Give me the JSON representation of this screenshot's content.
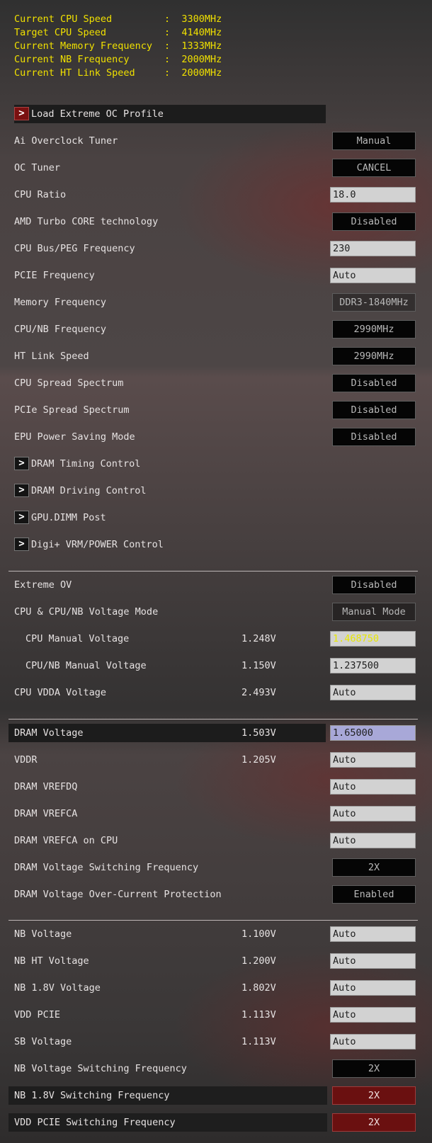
{
  "info": [
    {
      "label": "Current CPU Speed",
      "value": "3300MHz"
    },
    {
      "label": "Target CPU Speed",
      "value": "4140MHz"
    },
    {
      "label": "Current Memory Frequency",
      "value": "1333MHz"
    },
    {
      "label": "Current NB Frequency",
      "value": "2000MHz"
    },
    {
      "label": "Current HT Link Speed",
      "value": "2000MHz"
    }
  ],
  "load_profile": "Load Extreme OC Profile",
  "items": {
    "ai_overclock": {
      "label": "Ai Overclock Tuner",
      "value": "Manual"
    },
    "oc_tuner": {
      "label": "OC Tuner",
      "value": "CANCEL"
    },
    "cpu_ratio": {
      "label": "CPU Ratio",
      "value": "18.0"
    },
    "amd_turbo": {
      "label": "AMD Turbo CORE technology",
      "value": "Disabled"
    },
    "cpu_bus": {
      "label": "CPU Bus/PEG Frequency",
      "value": "230"
    },
    "pcie_freq": {
      "label": "PCIE Frequency",
      "value": "Auto"
    },
    "mem_freq": {
      "label": "Memory Frequency",
      "value": "DDR3-1840MHz"
    },
    "cpu_nb_freq": {
      "label": "CPU/NB Frequency",
      "value": "2990MHz"
    },
    "ht_link": {
      "label": "HT Link Speed",
      "value": "2990MHz"
    },
    "cpu_ss": {
      "label": "CPU Spread Spectrum",
      "value": "Disabled"
    },
    "pcie_ss": {
      "label": "PCIe Spread Spectrum",
      "value": "Disabled"
    },
    "epu": {
      "label": "EPU Power Saving Mode",
      "value": "Disabled"
    }
  },
  "submenus": {
    "dram_timing": "DRAM Timing Control",
    "dram_driving": "DRAM Driving Control",
    "gpu_dimm": "GPU.DIMM Post",
    "digi_vrm": "Digi+ VRM/POWER Control"
  },
  "voltage": {
    "extreme_ov": {
      "label": "Extreme OV",
      "value": "Disabled"
    },
    "volt_mode": {
      "label": "CPU & CPU/NB Voltage Mode",
      "value": "Manual Mode"
    },
    "cpu_manual": {
      "label": "CPU Manual Voltage",
      "current": "1.248V",
      "value": "1.468750"
    },
    "cpu_nb_manual": {
      "label": "CPU/NB Manual Voltage",
      "current": "1.150V",
      "value": "1.237500"
    },
    "cpu_vdda": {
      "label": "CPU VDDA Voltage",
      "current": "2.493V",
      "value": "Auto"
    }
  },
  "dram": {
    "dram_voltage": {
      "label": "DRAM Voltage",
      "current": "1.503V",
      "value": "1.65000"
    },
    "vddr": {
      "label": "VDDR",
      "current": "1.205V",
      "value": "Auto"
    },
    "vrefdq": {
      "label": "DRAM VREFDQ",
      "value": "Auto"
    },
    "vrefca": {
      "label": "DRAM VREFCA",
      "value": "Auto"
    },
    "vrefca_cpu": {
      "label": "DRAM VREFCA on CPU",
      "value": "Auto"
    },
    "dram_sw": {
      "label": "DRAM Voltage Switching Frequency",
      "value": "2X"
    },
    "dram_ocp": {
      "label": "DRAM Voltage Over-Current Protection",
      "value": "Enabled"
    }
  },
  "nb": {
    "nb_voltage": {
      "label": "NB Voltage",
      "current": "1.100V",
      "value": "Auto"
    },
    "nb_ht": {
      "label": "NB HT Voltage",
      "current": "1.200V",
      "value": "Auto"
    },
    "nb_18": {
      "label": "NB 1.8V Voltage",
      "current": "1.802V",
      "value": "Auto"
    },
    "vdd_pcie": {
      "label": "VDD PCIE",
      "current": "1.113V",
      "value": "Auto"
    },
    "sb_voltage": {
      "label": "SB Voltage",
      "current": "1.113V",
      "value": "Auto"
    },
    "nb_sw": {
      "label": "NB Voltage Switching Frequency",
      "value": "2X"
    },
    "nb18_sw": {
      "label": "NB 1.8V Switching Frequency",
      "value": "2X"
    },
    "vdd_pcie_sw": {
      "label": "VDD PCIE Switching Frequency",
      "value": "2X"
    }
  },
  "colors": {
    "info_text": "#f0e000",
    "selected_box": "#6a1010",
    "dram_input": "#a8a8d8"
  }
}
